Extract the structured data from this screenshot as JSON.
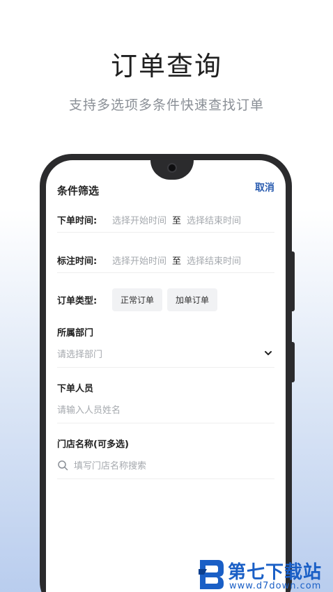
{
  "hero": {
    "title": "订单查询",
    "subtitle": "支持多选项多条件快速查找订单"
  },
  "panel": {
    "title": "条件筛选",
    "cancel_label": "取消"
  },
  "order_time": {
    "label": "下单时间:",
    "start_placeholder": "选择开始时间",
    "to": "至",
    "end_placeholder": "选择结束时间"
  },
  "mark_time": {
    "label": "标注时间:",
    "start_placeholder": "选择开始时间",
    "to": "至",
    "end_placeholder": "选择结束时间"
  },
  "order_type": {
    "label": "订单类型:",
    "options": [
      "正常订单",
      "加单订单"
    ]
  },
  "department": {
    "title": "所属部门",
    "placeholder": "请选择部门",
    "icon": "chevron-down-icon"
  },
  "orderer": {
    "title": "下单人员",
    "placeholder": "请输入人员姓名"
  },
  "store": {
    "title": "门店名称(可多选)",
    "placeholder": "填写门店名称搜索",
    "icon": "search-icon"
  },
  "watermark": {
    "name": "第七下载站",
    "url": "www.d7down.com"
  },
  "colors": {
    "accent": "#2a5cb0",
    "phone_frame": "#2b2b2d",
    "watermark": "#1a5fc6"
  }
}
